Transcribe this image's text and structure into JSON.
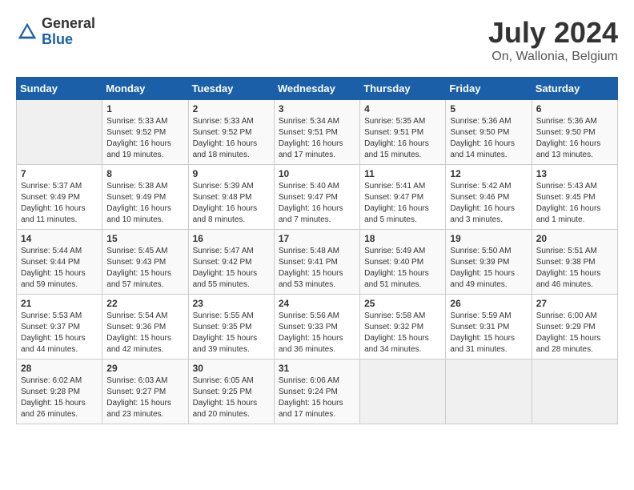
{
  "header": {
    "logo_general": "General",
    "logo_blue": "Blue",
    "month_year": "July 2024",
    "location": "On, Wallonia, Belgium"
  },
  "days_of_week": [
    "Sunday",
    "Monday",
    "Tuesday",
    "Wednesday",
    "Thursday",
    "Friday",
    "Saturday"
  ],
  "weeks": [
    [
      {
        "day": "",
        "sunrise": "",
        "sunset": "",
        "daylight": ""
      },
      {
        "day": "1",
        "sunrise": "Sunrise: 5:33 AM",
        "sunset": "Sunset: 9:52 PM",
        "daylight": "Daylight: 16 hours and 19 minutes."
      },
      {
        "day": "2",
        "sunrise": "Sunrise: 5:33 AM",
        "sunset": "Sunset: 9:52 PM",
        "daylight": "Daylight: 16 hours and 18 minutes."
      },
      {
        "day": "3",
        "sunrise": "Sunrise: 5:34 AM",
        "sunset": "Sunset: 9:51 PM",
        "daylight": "Daylight: 16 hours and 17 minutes."
      },
      {
        "day": "4",
        "sunrise": "Sunrise: 5:35 AM",
        "sunset": "Sunset: 9:51 PM",
        "daylight": "Daylight: 16 hours and 15 minutes."
      },
      {
        "day": "5",
        "sunrise": "Sunrise: 5:36 AM",
        "sunset": "Sunset: 9:50 PM",
        "daylight": "Daylight: 16 hours and 14 minutes."
      },
      {
        "day": "6",
        "sunrise": "Sunrise: 5:36 AM",
        "sunset": "Sunset: 9:50 PM",
        "daylight": "Daylight: 16 hours and 13 minutes."
      }
    ],
    [
      {
        "day": "7",
        "sunrise": "Sunrise: 5:37 AM",
        "sunset": "Sunset: 9:49 PM",
        "daylight": "Daylight: 16 hours and 11 minutes."
      },
      {
        "day": "8",
        "sunrise": "Sunrise: 5:38 AM",
        "sunset": "Sunset: 9:49 PM",
        "daylight": "Daylight: 16 hours and 10 minutes."
      },
      {
        "day": "9",
        "sunrise": "Sunrise: 5:39 AM",
        "sunset": "Sunset: 9:48 PM",
        "daylight": "Daylight: 16 hours and 8 minutes."
      },
      {
        "day": "10",
        "sunrise": "Sunrise: 5:40 AM",
        "sunset": "Sunset: 9:47 PM",
        "daylight": "Daylight: 16 hours and 7 minutes."
      },
      {
        "day": "11",
        "sunrise": "Sunrise: 5:41 AM",
        "sunset": "Sunset: 9:47 PM",
        "daylight": "Daylight: 16 hours and 5 minutes."
      },
      {
        "day": "12",
        "sunrise": "Sunrise: 5:42 AM",
        "sunset": "Sunset: 9:46 PM",
        "daylight": "Daylight: 16 hours and 3 minutes."
      },
      {
        "day": "13",
        "sunrise": "Sunrise: 5:43 AM",
        "sunset": "Sunset: 9:45 PM",
        "daylight": "Daylight: 16 hours and 1 minute."
      }
    ],
    [
      {
        "day": "14",
        "sunrise": "Sunrise: 5:44 AM",
        "sunset": "Sunset: 9:44 PM",
        "daylight": "Daylight: 15 hours and 59 minutes."
      },
      {
        "day": "15",
        "sunrise": "Sunrise: 5:45 AM",
        "sunset": "Sunset: 9:43 PM",
        "daylight": "Daylight: 15 hours and 57 minutes."
      },
      {
        "day": "16",
        "sunrise": "Sunrise: 5:47 AM",
        "sunset": "Sunset: 9:42 PM",
        "daylight": "Daylight: 15 hours and 55 minutes."
      },
      {
        "day": "17",
        "sunrise": "Sunrise: 5:48 AM",
        "sunset": "Sunset: 9:41 PM",
        "daylight": "Daylight: 15 hours and 53 minutes."
      },
      {
        "day": "18",
        "sunrise": "Sunrise: 5:49 AM",
        "sunset": "Sunset: 9:40 PM",
        "daylight": "Daylight: 15 hours and 51 minutes."
      },
      {
        "day": "19",
        "sunrise": "Sunrise: 5:50 AM",
        "sunset": "Sunset: 9:39 PM",
        "daylight": "Daylight: 15 hours and 49 minutes."
      },
      {
        "day": "20",
        "sunrise": "Sunrise: 5:51 AM",
        "sunset": "Sunset: 9:38 PM",
        "daylight": "Daylight: 15 hours and 46 minutes."
      }
    ],
    [
      {
        "day": "21",
        "sunrise": "Sunrise: 5:53 AM",
        "sunset": "Sunset: 9:37 PM",
        "daylight": "Daylight: 15 hours and 44 minutes."
      },
      {
        "day": "22",
        "sunrise": "Sunrise: 5:54 AM",
        "sunset": "Sunset: 9:36 PM",
        "daylight": "Daylight: 15 hours and 42 minutes."
      },
      {
        "day": "23",
        "sunrise": "Sunrise: 5:55 AM",
        "sunset": "Sunset: 9:35 PM",
        "daylight": "Daylight: 15 hours and 39 minutes."
      },
      {
        "day": "24",
        "sunrise": "Sunrise: 5:56 AM",
        "sunset": "Sunset: 9:33 PM",
        "daylight": "Daylight: 15 hours and 36 minutes."
      },
      {
        "day": "25",
        "sunrise": "Sunrise: 5:58 AM",
        "sunset": "Sunset: 9:32 PM",
        "daylight": "Daylight: 15 hours and 34 minutes."
      },
      {
        "day": "26",
        "sunrise": "Sunrise: 5:59 AM",
        "sunset": "Sunset: 9:31 PM",
        "daylight": "Daylight: 15 hours and 31 minutes."
      },
      {
        "day": "27",
        "sunrise": "Sunrise: 6:00 AM",
        "sunset": "Sunset: 9:29 PM",
        "daylight": "Daylight: 15 hours and 28 minutes."
      }
    ],
    [
      {
        "day": "28",
        "sunrise": "Sunrise: 6:02 AM",
        "sunset": "Sunset: 9:28 PM",
        "daylight": "Daylight: 15 hours and 26 minutes."
      },
      {
        "day": "29",
        "sunrise": "Sunrise: 6:03 AM",
        "sunset": "Sunset: 9:27 PM",
        "daylight": "Daylight: 15 hours and 23 minutes."
      },
      {
        "day": "30",
        "sunrise": "Sunrise: 6:05 AM",
        "sunset": "Sunset: 9:25 PM",
        "daylight": "Daylight: 15 hours and 20 minutes."
      },
      {
        "day": "31",
        "sunrise": "Sunrise: 6:06 AM",
        "sunset": "Sunset: 9:24 PM",
        "daylight": "Daylight: 15 hours and 17 minutes."
      },
      {
        "day": "",
        "sunrise": "",
        "sunset": "",
        "daylight": ""
      },
      {
        "day": "",
        "sunrise": "",
        "sunset": "",
        "daylight": ""
      },
      {
        "day": "",
        "sunrise": "",
        "sunset": "",
        "daylight": ""
      }
    ]
  ]
}
